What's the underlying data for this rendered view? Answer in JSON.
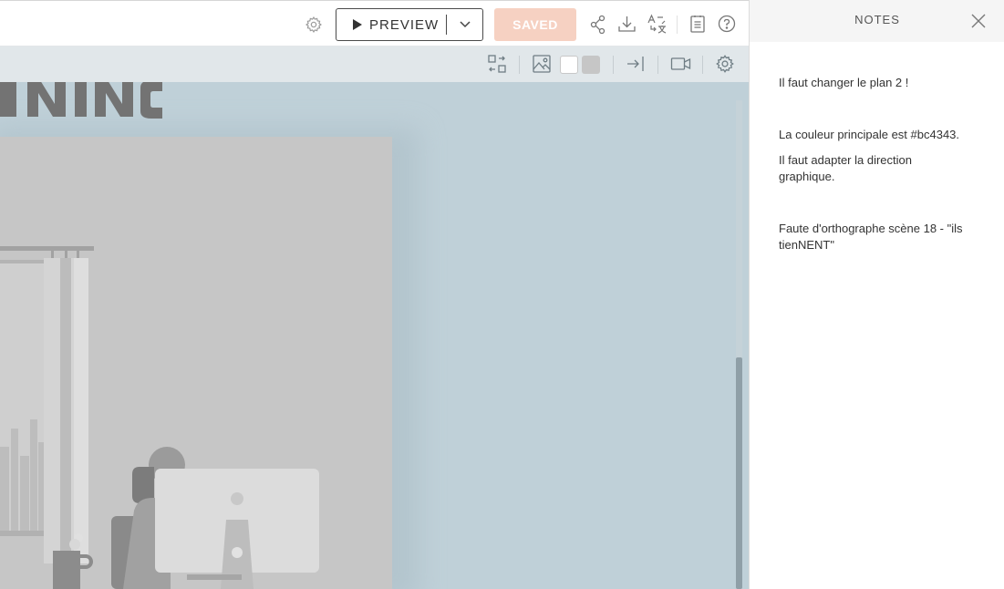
{
  "toolbar": {
    "preview_label": "PREVIEW",
    "saved_label": "SAVED",
    "icons": [
      "settings-icon",
      "play-icon",
      "chevron-down-icon",
      "share-icon",
      "download-icon",
      "translate-icon",
      "notes-icon",
      "help-icon"
    ]
  },
  "scene_toolbar": {
    "icons": [
      "swap-layout-icon",
      "image-icon",
      "enter-icon",
      "camera-icon",
      "settings-icon"
    ],
    "swatches": [
      "#ffffff",
      "#c6c6c6"
    ]
  },
  "canvas": {
    "background": "#bfd0d8"
  },
  "notes_panel": {
    "title": "NOTES",
    "notes": [
      {
        "text": "Il faut changer le plan 2 !"
      },
      {
        "text": "La couleur principale est #bc4343."
      },
      {
        "text": "Il faut adapter la direction graphique."
      },
      {
        "text": "Faute d'orthographe scène 18 - \"ils tienNENT\""
      }
    ]
  },
  "colors": {
    "saved_button": "#f6d1c2",
    "toolbar_secondary": "#e1e7ea",
    "scrollbar_thumb": "#8f9fa7"
  }
}
